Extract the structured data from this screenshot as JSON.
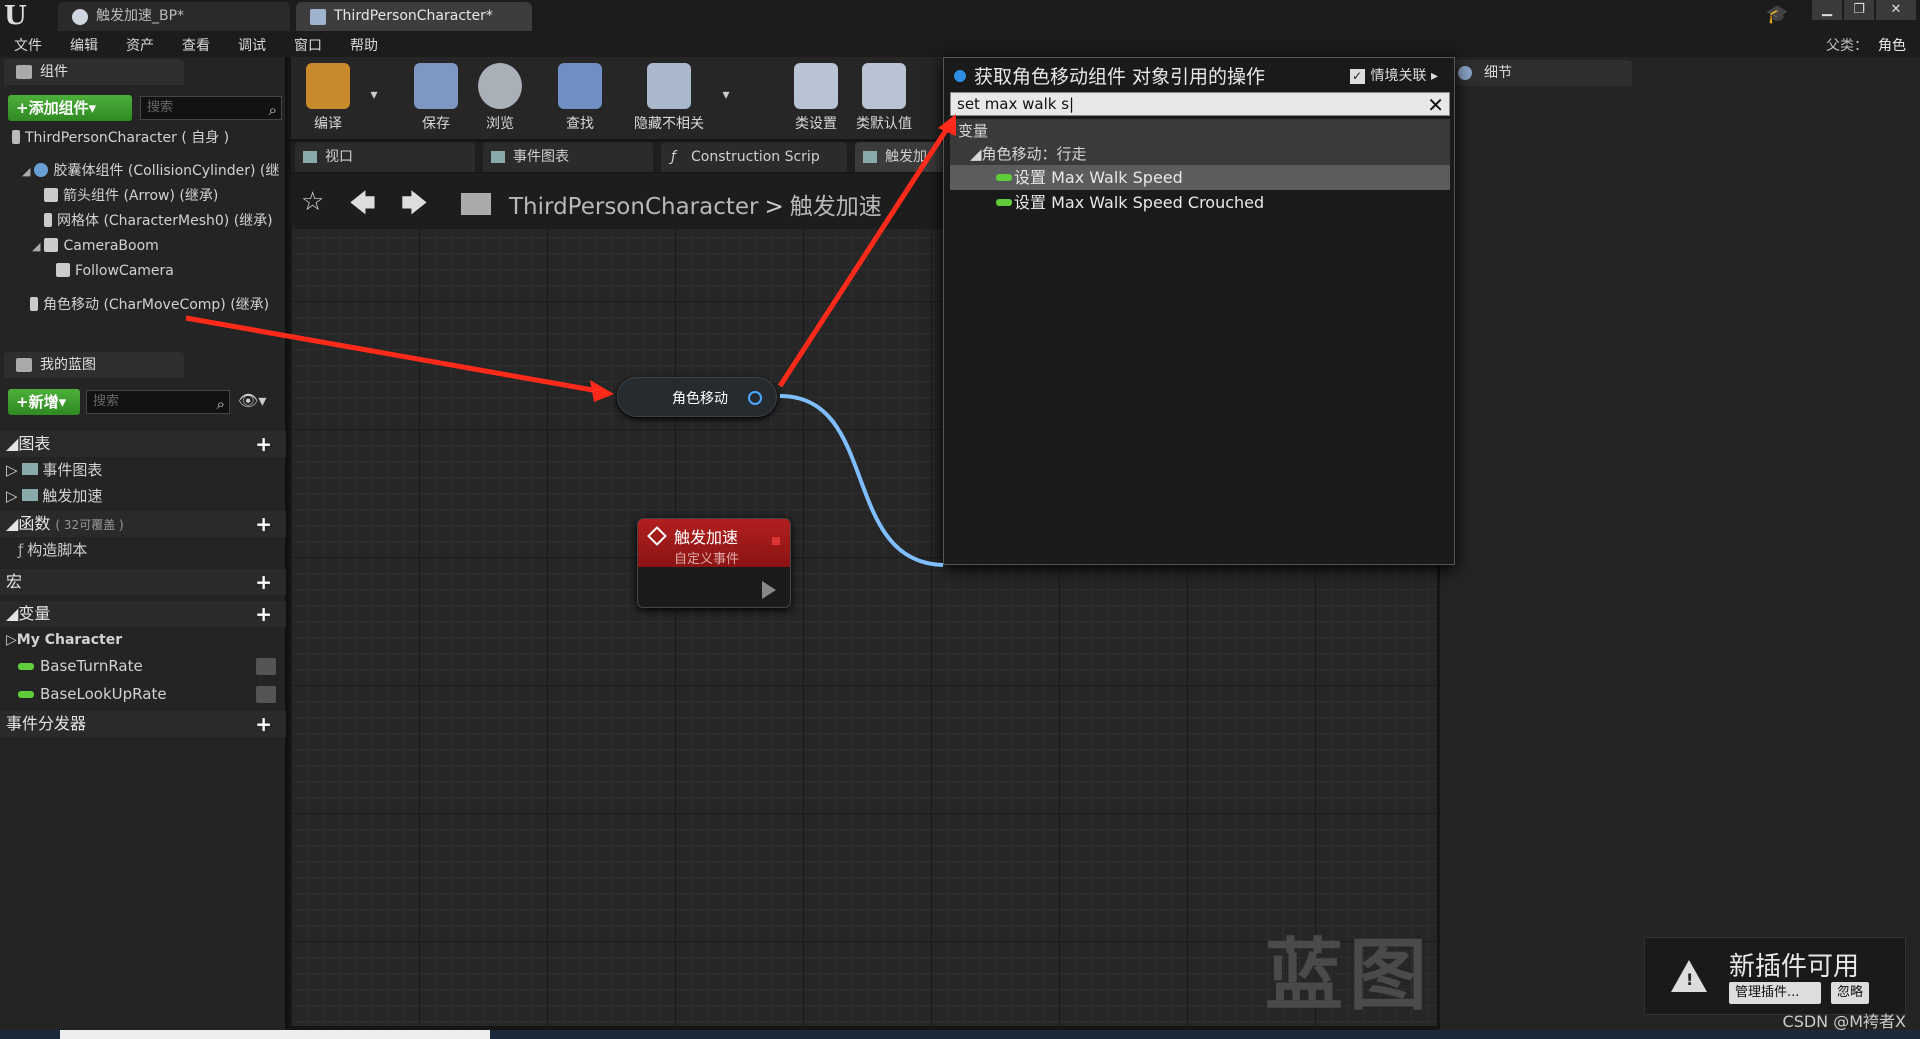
{
  "titlebar": {
    "tabs": [
      {
        "label": "触发加速_BP*",
        "active": false
      },
      {
        "label": "ThirdPersonCharacter*",
        "active": true
      }
    ],
    "parent_label": "父类：",
    "parent_value": "角色"
  },
  "menu": [
    "文件",
    "编辑",
    "资产",
    "查看",
    "调试",
    "窗口",
    "帮助"
  ],
  "components_panel": {
    "title": "组件",
    "add_button": "+添加组件▾",
    "search_placeholder": "搜索",
    "root": "ThirdPersonCharacter ( 自身 )",
    "items": [
      "胶囊体组件 (CollisionCylinder) (继",
      "箭头组件 (Arrow) (继承)",
      "网格体 (CharacterMesh0) (继承)",
      "CameraBoom",
      "FollowCamera",
      "角色移动 (CharMoveComp) (继承)"
    ]
  },
  "my_blueprint": {
    "title": "我的蓝图",
    "new_button": "+新增▾",
    "search_placeholder": "搜索",
    "sections": {
      "graphs": "图表",
      "graph_items": [
        "事件图表",
        "触发加速"
      ],
      "functions": "函数",
      "functions_sub": "( 32可覆盖 )",
      "function_items": [
        "构造脚本"
      ],
      "macros": "宏",
      "variables": "变量",
      "var_category": "My Character",
      "var_items": [
        "BaseTurnRate",
        "BaseLookUpRate"
      ],
      "dispatchers": "事件分发器"
    }
  },
  "toolbar": [
    "编译",
    "保存",
    "浏览",
    "查找",
    "隐藏不相关",
    "类设置",
    "类默认值"
  ],
  "graph_tabs": [
    "视口",
    "事件图表",
    "Construction Scrip",
    "触发加"
  ],
  "breadcrumb": {
    "root": "ThirdPersonCharacter",
    "sep": ">",
    "leaf": "触发加速"
  },
  "watermark": "蓝图",
  "nodes": {
    "char_move": "角色移动",
    "event_title": "触发加速",
    "event_sub": "自定义事件"
  },
  "details": {
    "tab": "细节"
  },
  "context_menu": {
    "title": "获取角色移动组件 对象引用的操作",
    "sensitive_label": "情境关联",
    "search_value": "set max walk s",
    "category": "变量",
    "subcategory": "角色移动：行走",
    "items": [
      {
        "label": "设置 Max Walk Speed",
        "selected": true
      },
      {
        "label": "设置 Max Walk Speed Crouched",
        "selected": false
      }
    ]
  },
  "notification": {
    "title": "新插件可用",
    "manage": "管理插件...",
    "ignore": "忽略"
  },
  "watermark_csdn": "CSDN @M袴者X",
  "colors": {
    "accent_blue": "#2c8fe3",
    "var_green": "#5fcc3a",
    "event_red": "#b21f1f",
    "arrow_red": "#ff2a1a",
    "wire_blue": "#7fbfff"
  }
}
